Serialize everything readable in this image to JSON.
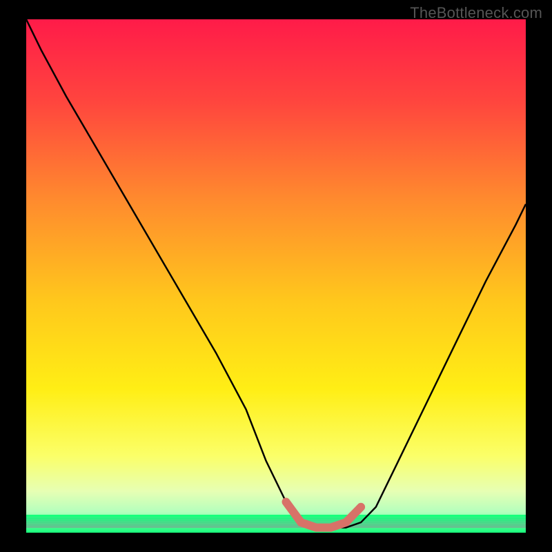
{
  "watermark": "TheBottleneck.com",
  "chart_data": {
    "type": "line",
    "title": "",
    "xlabel": "",
    "ylabel": "",
    "xlim": [
      0,
      100
    ],
    "ylim": [
      0,
      100
    ],
    "background_gradient_stops": [
      {
        "offset": 0,
        "color": "#ff1b49"
      },
      {
        "offset": 16,
        "color": "#ff453e"
      },
      {
        "offset": 35,
        "color": "#ff8a2e"
      },
      {
        "offset": 55,
        "color": "#ffc81c"
      },
      {
        "offset": 72,
        "color": "#ffee15"
      },
      {
        "offset": 85,
        "color": "#fbff68"
      },
      {
        "offset": 92,
        "color": "#e6ffb4"
      },
      {
        "offset": 96,
        "color": "#b4ffbd"
      },
      {
        "offset": 100,
        "color": "#18ff7c"
      }
    ],
    "series": [
      {
        "name": "bottleneck-curve",
        "x": [
          0,
          3,
          8,
          14,
          20,
          26,
          32,
          38,
          44,
          48,
          52,
          55,
          58,
          61,
          64,
          67,
          70,
          74,
          80,
          86,
          92,
          98,
          100
        ],
        "y": [
          100,
          94,
          85,
          75,
          65,
          55,
          45,
          35,
          24,
          14,
          6,
          2,
          1,
          1,
          1,
          2,
          5,
          13,
          25,
          37,
          49,
          60,
          64
        ]
      }
    ],
    "highlight_segment": {
      "name": "valley-highlight",
      "x": [
        52,
        55,
        58,
        61,
        64,
        67
      ],
      "y": [
        6,
        2,
        1,
        1,
        2,
        5
      ],
      "color": "#d87268",
      "stroke_width": 12
    },
    "green_bands": {
      "count": 6,
      "colors": [
        "#18ff7c",
        "#26f280",
        "#36e685",
        "#46da89",
        "#56ce8d",
        "#66c291"
      ]
    }
  }
}
